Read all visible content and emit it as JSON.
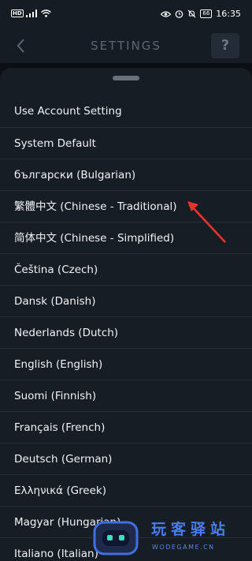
{
  "status_bar": {
    "hd_label": "HD",
    "battery": "66",
    "time": "16:35",
    "icons": [
      "signal-icon",
      "wifi-icon",
      "eye-icon",
      "alarm-icon",
      "mute-icon",
      "battery-icon"
    ]
  },
  "header": {
    "title": "SETTINGS",
    "back_icon": "chevron-left-icon",
    "help_label": "?"
  },
  "languages": [
    "Use Account Setting",
    "System Default",
    "български (Bulgarian)",
    "繁體中文 (Chinese - Traditional)",
    "简体中文 (Chinese - Simplified)",
    "Čeština (Czech)",
    "Dansk (Danish)",
    "Nederlands (Dutch)",
    "English (English)",
    "Suomi (Finnish)",
    "Français (French)",
    "Deutsch (German)",
    "Ελληνικά (Greek)",
    "Magyar (Hungarian)",
    "Italiano (Italian)"
  ],
  "annotation": {
    "color": "#e8332a",
    "icon": "red-arrow-icon"
  },
  "watermark": {
    "title": "玩客驿站",
    "url": "WODEGAME.CN"
  }
}
